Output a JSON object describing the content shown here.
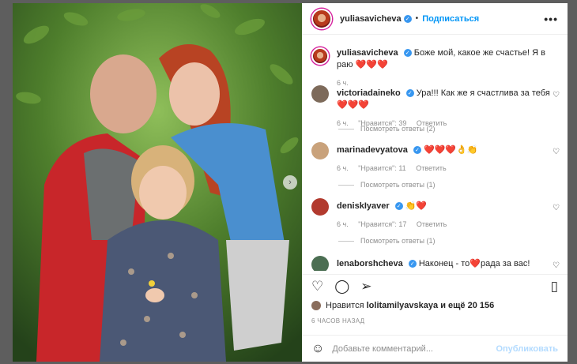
{
  "post": {
    "author": "yuliasavicheva",
    "follow_label": "Подписаться",
    "dot": "•",
    "more": "•••",
    "next_arrow": "›"
  },
  "caption": {
    "user": "yuliasavicheva",
    "text": "Боже мой, какое же счастье! Я в раю",
    "emoji": "❤️❤️❤️",
    "time": "6 ч."
  },
  "comments": [
    {
      "user": "victoriadaineko",
      "text": "Ура!!! Как же я счастлива за тебя",
      "emoji": "❤️❤️❤️",
      "time": "6 ч.",
      "likes": "\"Нравится\": 39",
      "reply": "Ответить",
      "replies": "Посмотреть ответы (2)",
      "avatar_color": "#7d6a5a"
    },
    {
      "user": "marinadevyatova",
      "text": "",
      "emoji": "❤️❤️❤️👌👏",
      "time": "6 ч.",
      "likes": "\"Нравится\": 11",
      "reply": "Ответить",
      "replies": "Посмотреть ответы (1)",
      "avatar_color": "#c9a27b"
    },
    {
      "user": "deniskIyaver",
      "text": "",
      "emoji": "👏❤️",
      "time": "6 ч.",
      "likes": "\"Нравится\": 17",
      "reply": "Ответить",
      "replies": "Посмотреть ответы (1)",
      "avatar_color": "#b23a2e"
    },
    {
      "user": "lenaborshcheva",
      "text": "Наконец - то",
      "text2": "рада за вас!",
      "emoji": "❤️",
      "avatar_color": "#4b6e52"
    }
  ],
  "likes": {
    "prefix": "Нравится",
    "user": "lolitamilyavskaya",
    "suffix": "и ещё 20 156"
  },
  "time_ago": "6 ЧАСОВ НАЗАД",
  "composer": {
    "placeholder": "Добавьте комментарий...",
    "publish": "Опубликовать"
  },
  "icons": {
    "like": "♡",
    "comment": "◯",
    "share": "➢",
    "save": "▯",
    "emoji": "☺",
    "comment_like": "♡"
  },
  "colors": {
    "accent": "#0095f6",
    "heart": "#e0101a",
    "publish_disabled": "#b3dbff"
  }
}
